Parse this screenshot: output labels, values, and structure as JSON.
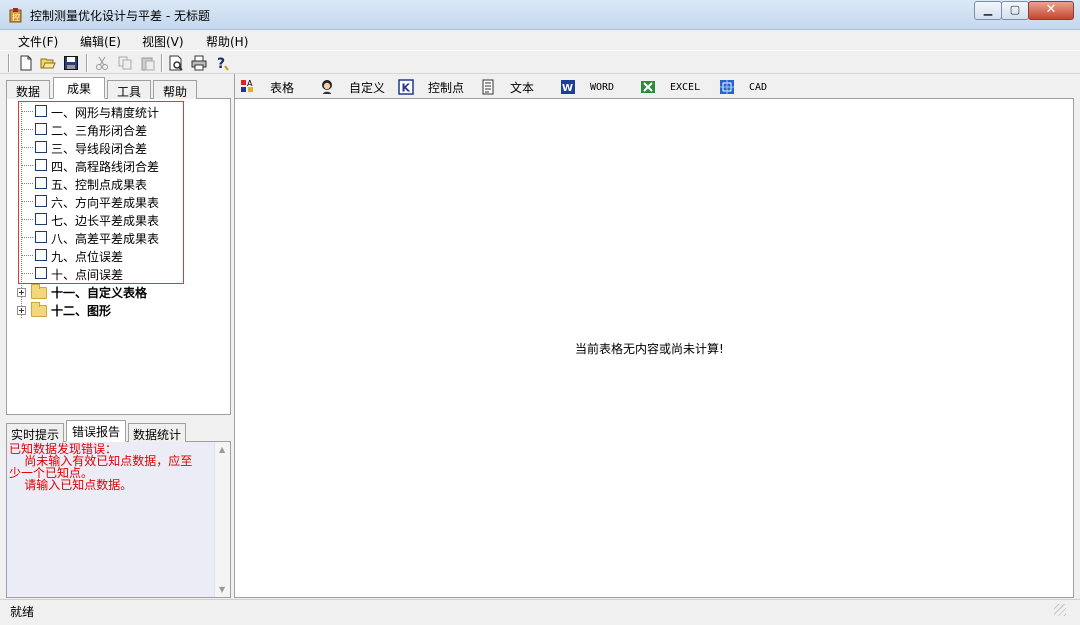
{
  "window": {
    "title": "控制测量优化设计与平差 - 无标题"
  },
  "menu": [
    "文件(F)",
    "编辑(E)",
    "视图(V)",
    "帮助(H)"
  ],
  "toolbar_icons": [
    "new-icon",
    "open-icon",
    "save-icon",
    "cut-icon",
    "copy-icon",
    "paste-icon",
    "print-preview-icon",
    "print-icon",
    "help-icon"
  ],
  "left_tabs": [
    "数据",
    "成果",
    "工具",
    "帮助"
  ],
  "left_active_tab": "成果",
  "tree_items": [
    "一、网形与精度统计",
    "二、三角形闭合差",
    "三、导线段闭合差",
    "四、高程路线闭合差",
    "五、控制点成果表",
    "六、方向平差成果表",
    "七、边长平差成果表",
    "八、高差平差成果表",
    "九、点位误差",
    "十、点间误差"
  ],
  "tree_groups": [
    "十一、自定义表格",
    "十二、图形"
  ],
  "bottom_tabs": [
    "实时提示",
    "错误报告",
    "数据统计"
  ],
  "bottom_active_tab": "错误报告",
  "report_lines": [
    "已知数据发现错误：",
    "    尚未输入有效已知点数据，应至",
    "少一个已知点。",
    "    请输入已知点数据。"
  ],
  "right_toolbar": [
    {
      "icon": "table-icon",
      "label": "表格"
    },
    {
      "icon": "custom-icon",
      "label": "自定义"
    },
    {
      "icon": "control-point-icon",
      "label": "控制点"
    },
    {
      "icon": "text-icon",
      "label": "文本"
    },
    {
      "icon": "word-icon",
      "label": "WORD"
    },
    {
      "icon": "excel-icon",
      "label": "EXCEL"
    },
    {
      "icon": "cad-icon",
      "label": "CAD"
    }
  ],
  "content_message": "当前表格无内容或尚未计算!",
  "status": "就绪",
  "colors": {
    "error_text": "#e00000",
    "highlight_box": "#e03838",
    "title_bar": "#c5d8ef"
  }
}
